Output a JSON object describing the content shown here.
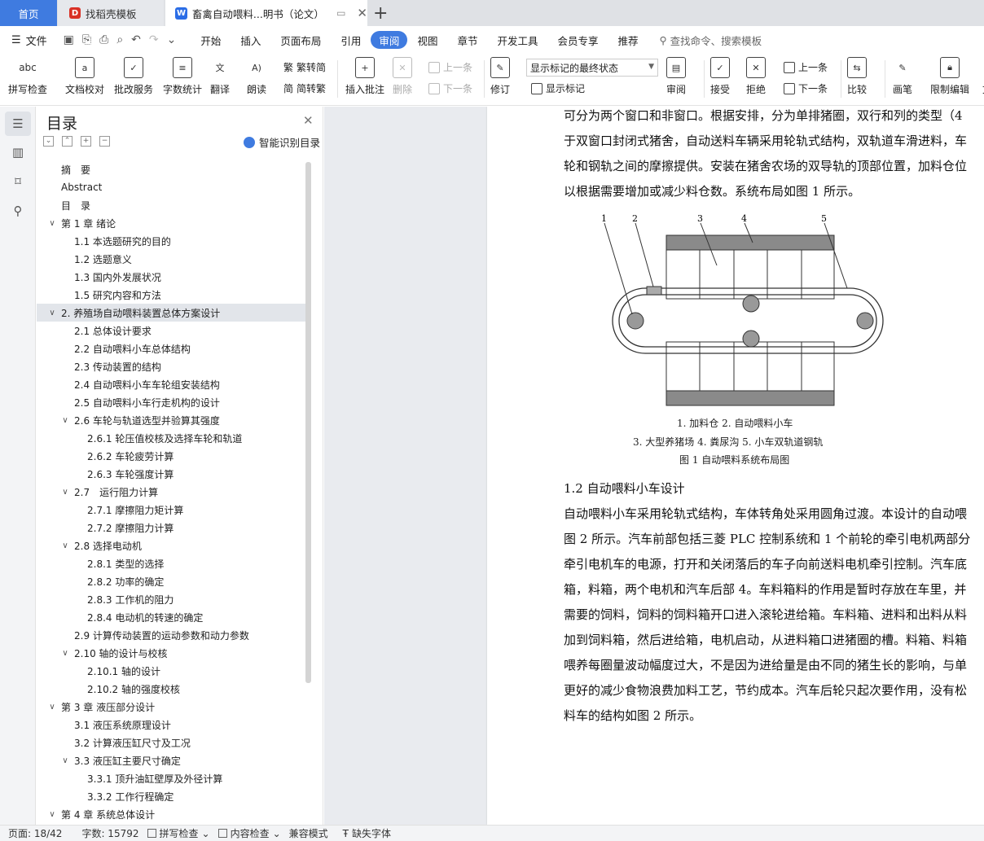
{
  "tabs": {
    "home": "首页",
    "template": "找稻壳模板",
    "document": "畜禽自动喂料...明书（论文）"
  },
  "menu": {
    "file": "文件",
    "items": [
      "开始",
      "插入",
      "页面布局",
      "引用",
      "审阅",
      "视图",
      "章节",
      "开发工具",
      "会员专享",
      "推荐"
    ],
    "active": "审阅",
    "search_placeholder": "查找命令、搜索模板"
  },
  "ribbon": {
    "spell_check": "拼写检查",
    "doc_proof": "文档校对",
    "batch_service": "批改服务",
    "word_count": "字数统计",
    "translate": "翻译",
    "read_aloud": "朗读",
    "trad_to_simp": "繁转简",
    "simp_to_trad": "简转繁",
    "insert_comment": "插入批注",
    "delete": "删除",
    "prev": "上一条",
    "next": "下一条",
    "revise": "修订",
    "markup_state": "显示标记的最终状态",
    "show_markup": "显示标记",
    "review": "审阅",
    "accept": "接受",
    "reject": "拒绝",
    "prev2": "上一条",
    "next2": "下一条",
    "compare": "比较",
    "pen": "画笔",
    "restrict_edit": "限制编辑",
    "doc_overflow": "文"
  },
  "toc": {
    "title": "目录",
    "smart": "智能识别目录",
    "items": [
      {
        "label": "摘　要",
        "level": 1,
        "caret": ""
      },
      {
        "label": "Abstract",
        "level": 1,
        "caret": ""
      },
      {
        "label": "目　录",
        "level": 1,
        "caret": ""
      },
      {
        "label": "第 1 章  绪论",
        "level": 1,
        "caret": "v"
      },
      {
        "label": "1.1 本选题研究的目的",
        "level": 2,
        "caret": ""
      },
      {
        "label": "1.2 选题意义",
        "level": 2,
        "caret": ""
      },
      {
        "label": "1.3 国内外发展状况",
        "level": 2,
        "caret": ""
      },
      {
        "label": "1.5 研究内容和方法",
        "level": 2,
        "caret": ""
      },
      {
        "label": "2.  养殖场自动喂料装置总体方案设计",
        "level": 1,
        "caret": "v",
        "selected": true
      },
      {
        "label": "2.1  总体设计要求",
        "level": 2,
        "caret": ""
      },
      {
        "label": "2.2  自动喂料小车总体结构",
        "level": 2,
        "caret": ""
      },
      {
        "label": "2.3  传动装置的结构",
        "level": 2,
        "caret": ""
      },
      {
        "label": "2.4  自动喂料小车车轮组安装结构",
        "level": 2,
        "caret": ""
      },
      {
        "label": "2.5 自动喂料小车行走机构的设计",
        "level": 2,
        "caret": ""
      },
      {
        "label": "2.6 车轮与轨道选型并验算其强度",
        "level": 2,
        "caret": "v"
      },
      {
        "label": "2.6.1 轮压值校核及选择车轮和轨道",
        "level": 3,
        "caret": ""
      },
      {
        "label": "2.6.2 车轮疲劳计算",
        "level": 3,
        "caret": ""
      },
      {
        "label": "2.6.3 车轮强度计算",
        "level": 3,
        "caret": ""
      },
      {
        "label": "2.7　运行阻力计算",
        "level": 2,
        "caret": "v"
      },
      {
        "label": "2.7.1 摩擦阻力矩计算",
        "level": 3,
        "caret": ""
      },
      {
        "label": "2.7.2 摩擦阻力计算",
        "level": 3,
        "caret": ""
      },
      {
        "label": "2.8  选择电动机",
        "level": 2,
        "caret": "v"
      },
      {
        "label": "2.8.1 类型的选择",
        "level": 3,
        "caret": ""
      },
      {
        "label": "2.8.2 功率的确定",
        "level": 3,
        "caret": ""
      },
      {
        "label": "2.8.3 工作机的阻力",
        "level": 3,
        "caret": ""
      },
      {
        "label": "2.8.4 电动机的转速的确定",
        "level": 3,
        "caret": ""
      },
      {
        "label": "2.9 计算传动装置的运动参数和动力参数",
        "level": 2,
        "caret": ""
      },
      {
        "label": "2.10 轴的设计与校核",
        "level": 2,
        "caret": "v"
      },
      {
        "label": "2.10.1 轴的设计",
        "level": 3,
        "caret": ""
      },
      {
        "label": "2.10.2  轴的强度校核",
        "level": 3,
        "caret": ""
      },
      {
        "label": "第 3 章  液压部分设计",
        "level": 1,
        "caret": "v"
      },
      {
        "label": "3.1  液压系统原理设计",
        "level": 2,
        "caret": ""
      },
      {
        "label": "3.2 计算液压缸尺寸及工况",
        "level": 2,
        "caret": ""
      },
      {
        "label": "3.3 液压缸主要尺寸确定",
        "level": 2,
        "caret": "v"
      },
      {
        "label": "3.3.1 顶升油缸壁厚及外径计算",
        "level": 3,
        "caret": ""
      },
      {
        "label": "3.3.2 工作行程确定",
        "level": 3,
        "caret": ""
      },
      {
        "label": "第 4 章  系统总体设计",
        "level": 1,
        "caret": "v"
      }
    ]
  },
  "document": {
    "lines_top": [
      "可分为两个窗口和非窗口。根据安排，分为单排猪圈，双行和列的类型（4",
      "于双窗口封闭式猪舍，自动送料车辆采用轮轨式结构，双轨道车滑进料，车",
      "轮和钢轨之间的摩擦提供。安装在猪舍农场的双导轨的顶部位置，加料仓位",
      "以根据需要增加或减少料仓数。系统布局如图 1 所示。"
    ],
    "figure_labels": [
      "1",
      "2",
      "3",
      "4",
      "5"
    ],
    "figure_caption_1": "1. 加料仓   2. 自动喂料小车",
    "figure_caption_2": "3. 大型养猪场   4. 粪尿沟   5. 小车双轨道钢轨",
    "figure_title": "图 1    自动喂料系统布局图",
    "section_heading": "1.2  自动喂料小车设计",
    "lines_bottom": [
      "自动喂料小车采用轮轨式结构，车体转角处采用圆角过渡。本设计的自动喂",
      "图 2 所示。汽车前部包括三菱 PLC 控制系统和 1 个前轮的牵引电机两部分",
      "牵引电机车的电源，打开和关闭落后的车子向前送料电机牵引控制。汽车底",
      "箱，料箱，两个电机和汽车后部 4。车料箱料的作用是暂时存放在车里，并",
      "需要的饲料，饲料的饲料箱开口进入滚轮进给箱。车料箱、进料和出料从料",
      "加到饲料箱，然后进给箱，电机启动，从进料箱口进猪圈的槽。料箱、料箱",
      "喂养每圈量波动幅度过大，不是因为进给量是由不同的猪生长的影响，与单",
      "更好的减少食物浪费加料工艺，节约成本。汽车后轮只起次要作用，没有松",
      "料车的结构如图 2 所示。"
    ]
  },
  "status": {
    "page": "页面: 18/42",
    "words": "字数: 15792",
    "spell": "拼写检查",
    "content_check": "内容检查",
    "compat": "兼容模式",
    "missing_font": "缺失字体"
  }
}
